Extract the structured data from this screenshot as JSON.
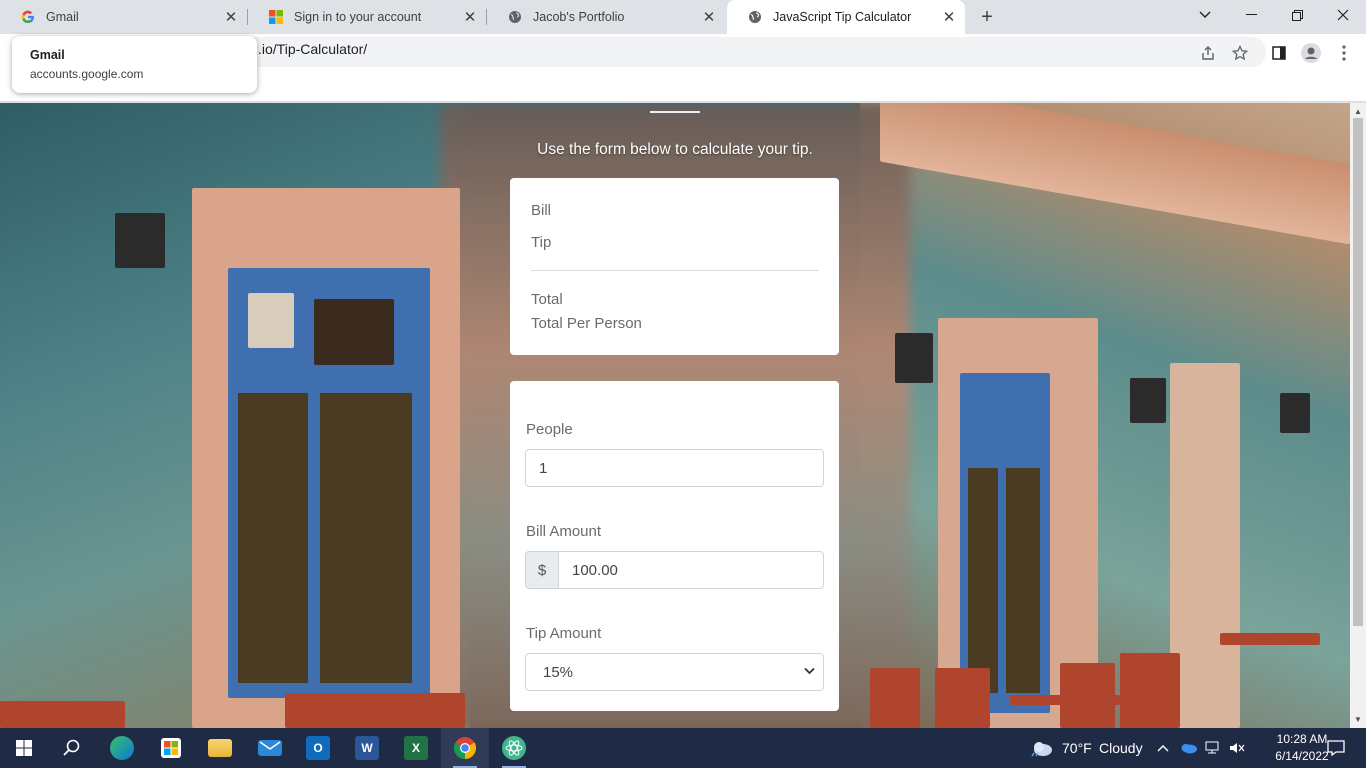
{
  "browser": {
    "tabs": [
      {
        "label": "Gmail",
        "icon": "google-g-icon"
      },
      {
        "label": "Sign in to your account",
        "icon": "microsoft-icon"
      },
      {
        "label": "Jacob's Portfolio",
        "icon": "globe-icon"
      },
      {
        "label": "JavaScript Tip Calculator",
        "icon": "globe-icon",
        "active": true
      }
    ],
    "close_glyph": "✕",
    "new_tab_glyph": "+",
    "url_visible": ".io/Tip-Calculator/",
    "hover_card": {
      "title": "Gmail",
      "domain": "accounts.google.com"
    }
  },
  "page": {
    "subtitle": "Use the form below to calculate your tip.",
    "summary": {
      "bill_label": "Bill",
      "tip_label": "Tip",
      "total_label": "Total",
      "per_person_label": "Total Per Person"
    },
    "form": {
      "people_label": "People",
      "people_value": "1",
      "bill_label": "Bill Amount",
      "currency_prefix": "$",
      "bill_value": "100.00",
      "tip_label": "Tip Amount",
      "tip_selected": "15%"
    }
  },
  "taskbar": {
    "weather_temp": "70°F",
    "weather_desc": "Cloudy",
    "time": "10:28 AM",
    "date": "6/14/2022"
  },
  "colors": {
    "taskbar": "#1f2a44",
    "tabstrip": "#dee1e6",
    "card": "#ffffff"
  }
}
